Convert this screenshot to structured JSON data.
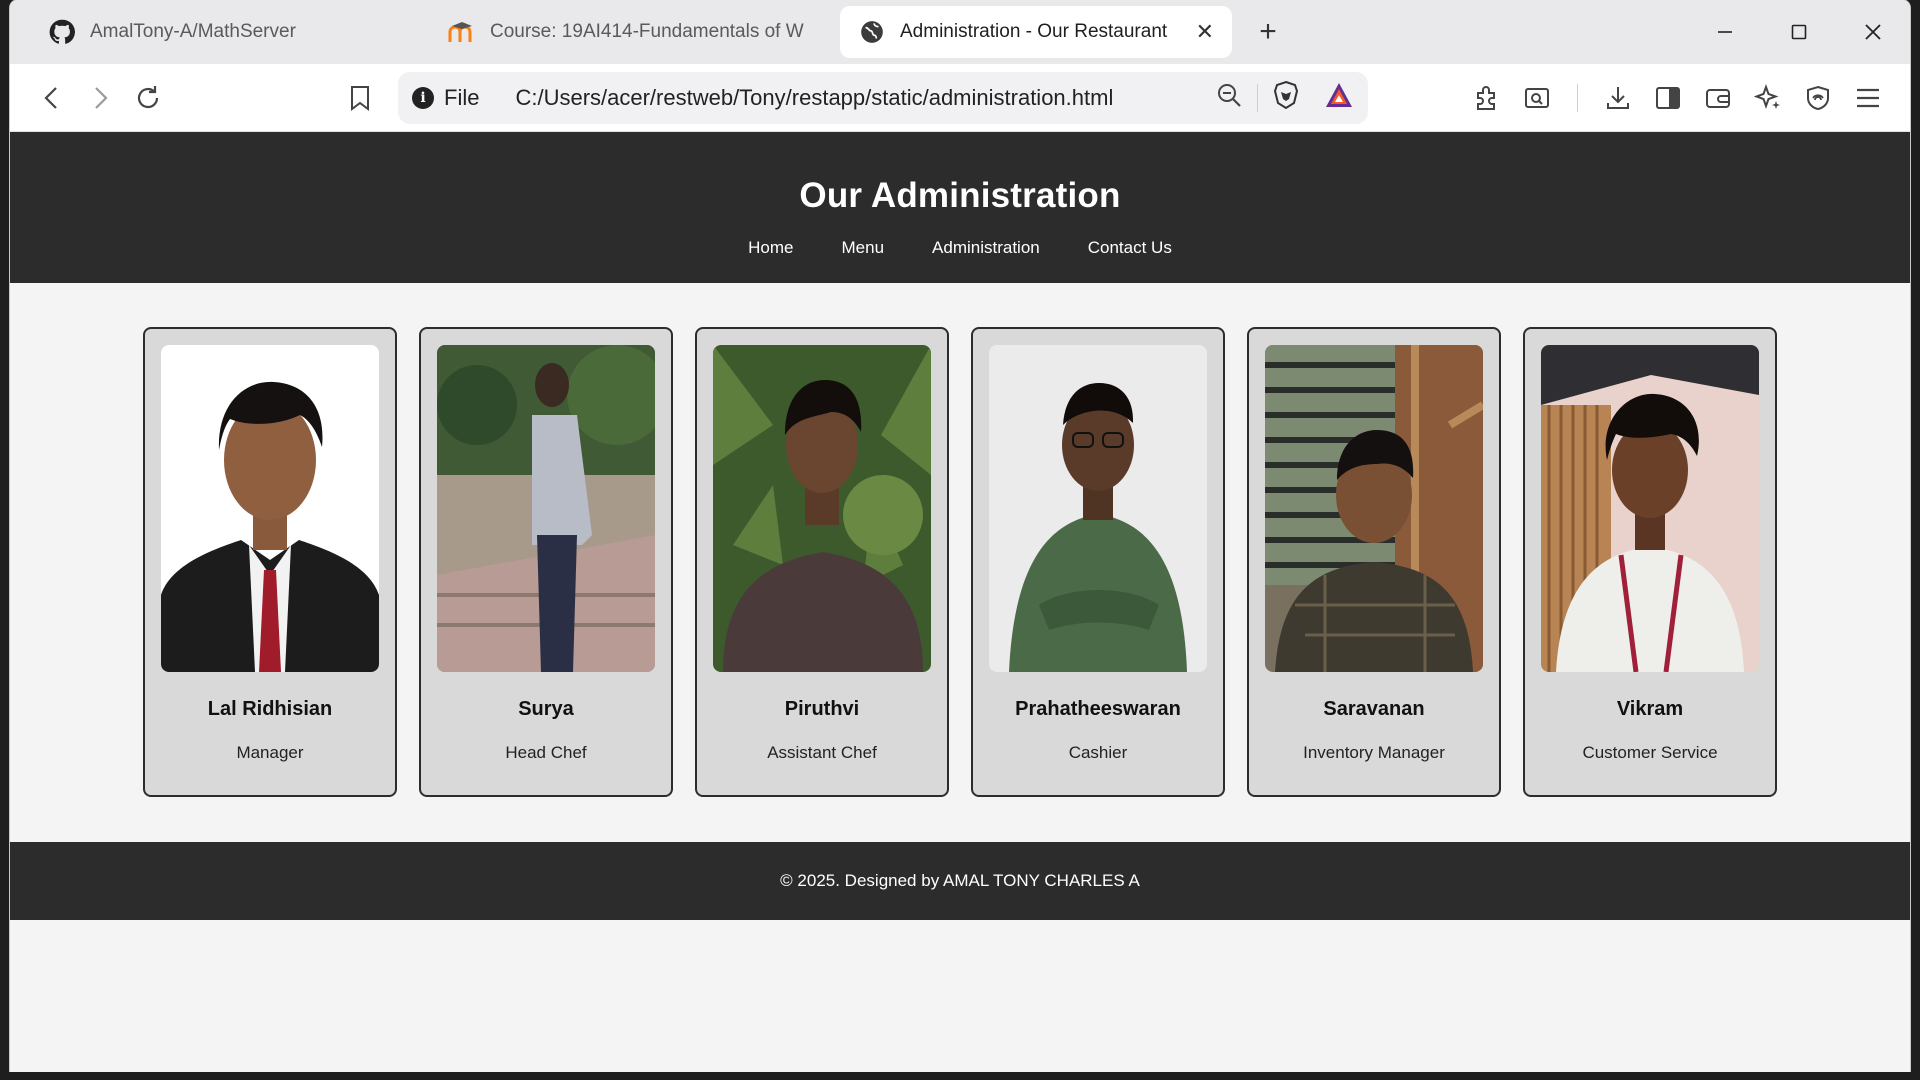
{
  "browser": {
    "tabs": [
      {
        "title": "AmalTony-A/MathServer",
        "favicon": "github-icon",
        "active": false
      },
      {
        "title": "Course: 19AI414-Fundamentals of W",
        "favicon": "moodle-icon",
        "active": false
      },
      {
        "title": "Administration - Our Restaurant",
        "favicon": "globe-icon",
        "active": true
      }
    ],
    "close_tab_glyph": "✕",
    "new_tab_glyph": "+",
    "window_controls": {
      "minimize": "—",
      "maximize": "☐",
      "close": "✕"
    },
    "address": {
      "scheme_label": "File",
      "url": "C:/Users/acer/restweb/Tony/restapp/static/administration.html"
    }
  },
  "site": {
    "title": "Our Administration",
    "nav": [
      "Home",
      "Menu",
      "Administration",
      "Contact Us"
    ],
    "staff": [
      {
        "name": "Lal Ridhisian",
        "role": "Manager"
      },
      {
        "name": "Surya",
        "role": "Head Chef"
      },
      {
        "name": "Piruthvi",
        "role": "Assistant Chef"
      },
      {
        "name": "Prahatheeswaran",
        "role": "Cashier"
      },
      {
        "name": "Saravanan",
        "role": "Inventory Manager"
      },
      {
        "name": "Vikram",
        "role": "Customer Service"
      }
    ],
    "footer": "© 2025. Designed by AMAL TONY CHARLES A"
  },
  "colors": {
    "header_bg": "#2c2c2c",
    "card_bg": "#d9d9d9",
    "page_bg": "#f4f4f4",
    "brave_orange": "#f15a2c"
  }
}
